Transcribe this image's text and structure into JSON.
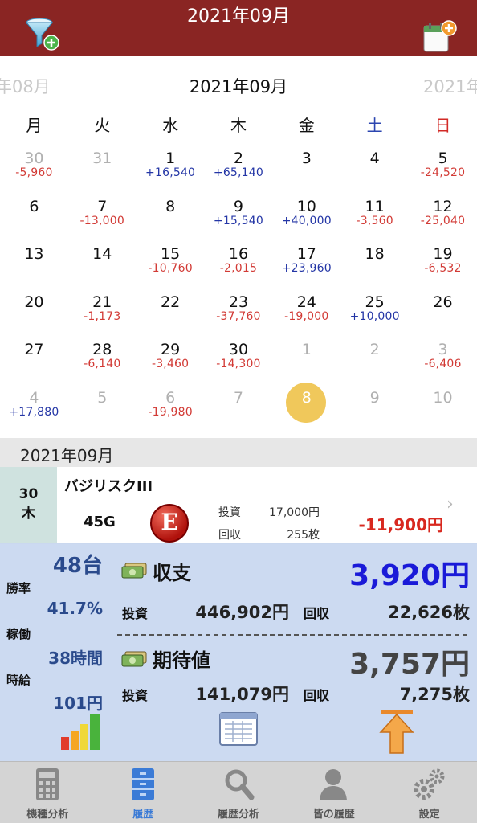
{
  "header": {
    "title": "2021年09月"
  },
  "month_nav": {
    "prev": "年08月",
    "current": "2021年09月",
    "next": "2021年"
  },
  "weekdays": [
    "月",
    "火",
    "水",
    "木",
    "金",
    "土",
    "日"
  ],
  "calendar": [
    {
      "day": "30",
      "amount": "-5,960",
      "other": true
    },
    {
      "day": "31",
      "amount": "",
      "other": true
    },
    {
      "day": "1",
      "amount": "+16,540"
    },
    {
      "day": "2",
      "amount": "+65,140"
    },
    {
      "day": "3",
      "amount": ""
    },
    {
      "day": "4",
      "amount": ""
    },
    {
      "day": "5",
      "amount": "-24,520"
    },
    {
      "day": "6",
      "amount": ""
    },
    {
      "day": "7",
      "amount": "-13,000"
    },
    {
      "day": "8",
      "amount": ""
    },
    {
      "day": "9",
      "amount": "+15,540"
    },
    {
      "day": "10",
      "amount": "+40,000"
    },
    {
      "day": "11",
      "amount": "-3,560"
    },
    {
      "day": "12",
      "amount": "-25,040"
    },
    {
      "day": "13",
      "amount": ""
    },
    {
      "day": "14",
      "amount": ""
    },
    {
      "day": "15",
      "amount": "-10,760"
    },
    {
      "day": "16",
      "amount": "-2,015"
    },
    {
      "day": "17",
      "amount": "+23,960"
    },
    {
      "day": "18",
      "amount": ""
    },
    {
      "day": "19",
      "amount": "-6,532"
    },
    {
      "day": "20",
      "amount": ""
    },
    {
      "day": "21",
      "amount": "-1,173"
    },
    {
      "day": "22",
      "amount": ""
    },
    {
      "day": "23",
      "amount": "-37,760"
    },
    {
      "day": "24",
      "amount": "-19,000"
    },
    {
      "day": "25",
      "amount": "+10,000"
    },
    {
      "day": "26",
      "amount": ""
    },
    {
      "day": "27",
      "amount": ""
    },
    {
      "day": "28",
      "amount": "-6,140"
    },
    {
      "day": "29",
      "amount": "-3,460"
    },
    {
      "day": "30",
      "amount": "-14,300"
    },
    {
      "day": "1",
      "amount": "",
      "other": true
    },
    {
      "day": "2",
      "amount": "",
      "other": true
    },
    {
      "day": "3",
      "amount": "-6,406",
      "other": true
    },
    {
      "day": "4",
      "amount": "+17,880",
      "other": true
    },
    {
      "day": "5",
      "amount": "",
      "other": true
    },
    {
      "day": "6",
      "amount": "-19,980",
      "other": true
    },
    {
      "day": "7",
      "amount": "",
      "other": true
    },
    {
      "day": "8",
      "amount": "",
      "other": true,
      "today": true
    },
    {
      "day": "9",
      "amount": "",
      "other": true
    },
    {
      "day": "10",
      "amount": "",
      "other": true
    }
  ],
  "list": {
    "header": "2021年09月",
    "entries": [
      {
        "date_day": "30",
        "date_weekday": "木",
        "machine": "バジリスクIII",
        "games": "45G",
        "badge": "E",
        "invest_label": "投資",
        "invest_value": "17,000円",
        "return_label": "回収",
        "return_value": "255枚",
        "result": "-11,900円"
      }
    ]
  },
  "summary": {
    "units": "48台",
    "win_rate_label": "勝率",
    "win_rate": "41.7%",
    "operation_label": "稼働",
    "operation_hours": "38時間",
    "hourly_label": "時給",
    "hourly": "101円",
    "balance_title": "収支",
    "balance_amount": "3,920円",
    "balance_invest_label": "投資",
    "balance_invest": "446,902円",
    "balance_return_label": "回収",
    "balance_return": "22,626枚",
    "expected_title": "期待値",
    "expected_amount": "3,757円",
    "expected_invest_label": "投資",
    "expected_invest": "141,079円",
    "expected_return_label": "回収",
    "expected_return": "7,275枚",
    "colors": {
      "balance": "#1a1ad8",
      "expected": "#444444"
    }
  },
  "tabs": [
    {
      "label": "機種分析",
      "icon": "calculator-icon"
    },
    {
      "label": "履歴",
      "icon": "cabinet-icon",
      "active": true
    },
    {
      "label": "履歴分析",
      "icon": "magnifier-icon"
    },
    {
      "label": "皆の履歴",
      "icon": "person-icon"
    },
    {
      "label": "設定",
      "icon": "gears-icon"
    }
  ],
  "colors": {
    "topbar": "#8a2523",
    "positive": "#2436a6",
    "negative": "#d23a35",
    "today": "#f0c85b",
    "tab_active": "#3b7bd6"
  }
}
